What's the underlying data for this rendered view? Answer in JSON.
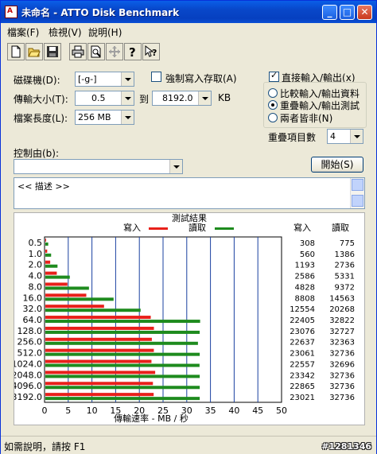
{
  "window": {
    "title": "未命名 - ATTO Disk Benchmark",
    "icon_text": "A"
  },
  "titlebar_buttons": [
    "_",
    "□",
    "✕"
  ],
  "menu": [
    {
      "label": "檔案(F)"
    },
    {
      "label": "檢視(V)"
    },
    {
      "label": "說明(H)"
    }
  ],
  "toolbar": [
    "new-file-icon",
    "open-folder-icon",
    "save-icon",
    "print-icon",
    "print-preview-icon",
    "move-icon",
    "help-icon",
    "context-help-icon"
  ],
  "form": {
    "drive_label": "磁碟機(D):",
    "drive_value": "[-g-]",
    "transfer_label": "傳輸大小(T):",
    "transfer_from": "0.5",
    "transfer_to_label": "到",
    "transfer_to": "8192.0",
    "transfer_unit": "KB",
    "length_label": "檔案長度(L):",
    "length_value": "256 MB",
    "force_write_label": "強制寫入存取(A)",
    "force_write_checked": false,
    "direct_io_label": "直接輸入/輸出(x)",
    "direct_io_checked": true,
    "radio_compare": "比較輸入/輸出資料",
    "radio_overlap": "重疊輸入/輸出測試",
    "radio_neither": "兩者皆非(N)",
    "selected_radio": "radio_overlap",
    "queue_label": "重疊項目數",
    "queue_value": "4",
    "controlled_by_label": "控制由(b):",
    "controlled_by_value": "",
    "start_button": "開始(S)",
    "description_text": "<<   描述   >>"
  },
  "results": {
    "title": "測試結果",
    "legend_write": "寫入",
    "legend_read": "讀取",
    "col_write": "寫入",
    "col_read": "讀取",
    "axis_label": "傳輸速率 - MB / 秒"
  },
  "colors": {
    "write": "#e8201a",
    "read": "#1e8b1e",
    "titlebar": "#0a54e0"
  },
  "chart_data": {
    "type": "bar",
    "orientation": "horizontal",
    "categories": [
      "0.5",
      "1.0",
      "2.0",
      "4.0",
      "8.0",
      "16.0",
      "32.0",
      "64.0",
      "128.0",
      "256.0",
      "512.0",
      "1024.0",
      "2048.0",
      "4096.0",
      "3192.0"
    ],
    "series": [
      {
        "name": "寫入",
        "values": [
          308,
          560,
          1193,
          2586,
          4828,
          8808,
          12554,
          22405,
          23076,
          22637,
          23061,
          22557,
          23342,
          22865,
          23021
        ]
      },
      {
        "name": "讀取",
        "values": [
          775,
          1386,
          2736,
          5331,
          9372,
          14563,
          20268,
          32822,
          32727,
          32363,
          32736,
          32696,
          32736,
          32736,
          32736
        ]
      }
    ],
    "xlim": [
      0,
      50
    ],
    "xticks": [
      "0",
      "5",
      "10",
      "15",
      "20",
      "25",
      "30",
      "35",
      "40",
      "45",
      "50"
    ],
    "xlabel": "傳輸速率 - MB / 秒",
    "grid": true,
    "legend": "top"
  },
  "status_bar": {
    "text": "如需說明，請按 F1",
    "watermark": "#1281346"
  }
}
